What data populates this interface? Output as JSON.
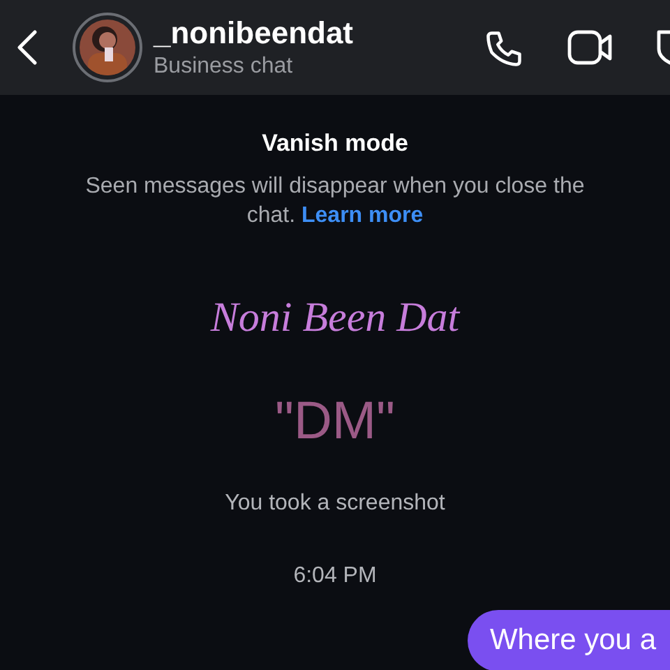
{
  "header": {
    "username": "_nonibeendat",
    "subtitle": "Business chat"
  },
  "notice": {
    "title": "Vanish mode",
    "text": "Seen messages will disappear when you close the chat.",
    "link": "Learn more"
  },
  "messages": [
    {
      "kind": "script",
      "text": "Noni Been Dat"
    },
    {
      "kind": "dm",
      "text": "\"DM\""
    },
    {
      "kind": "event",
      "text": "You took a screenshot"
    },
    {
      "kind": "time",
      "text": "6:04 PM"
    },
    {
      "kind": "outgoing",
      "text": "Where you a"
    }
  ]
}
